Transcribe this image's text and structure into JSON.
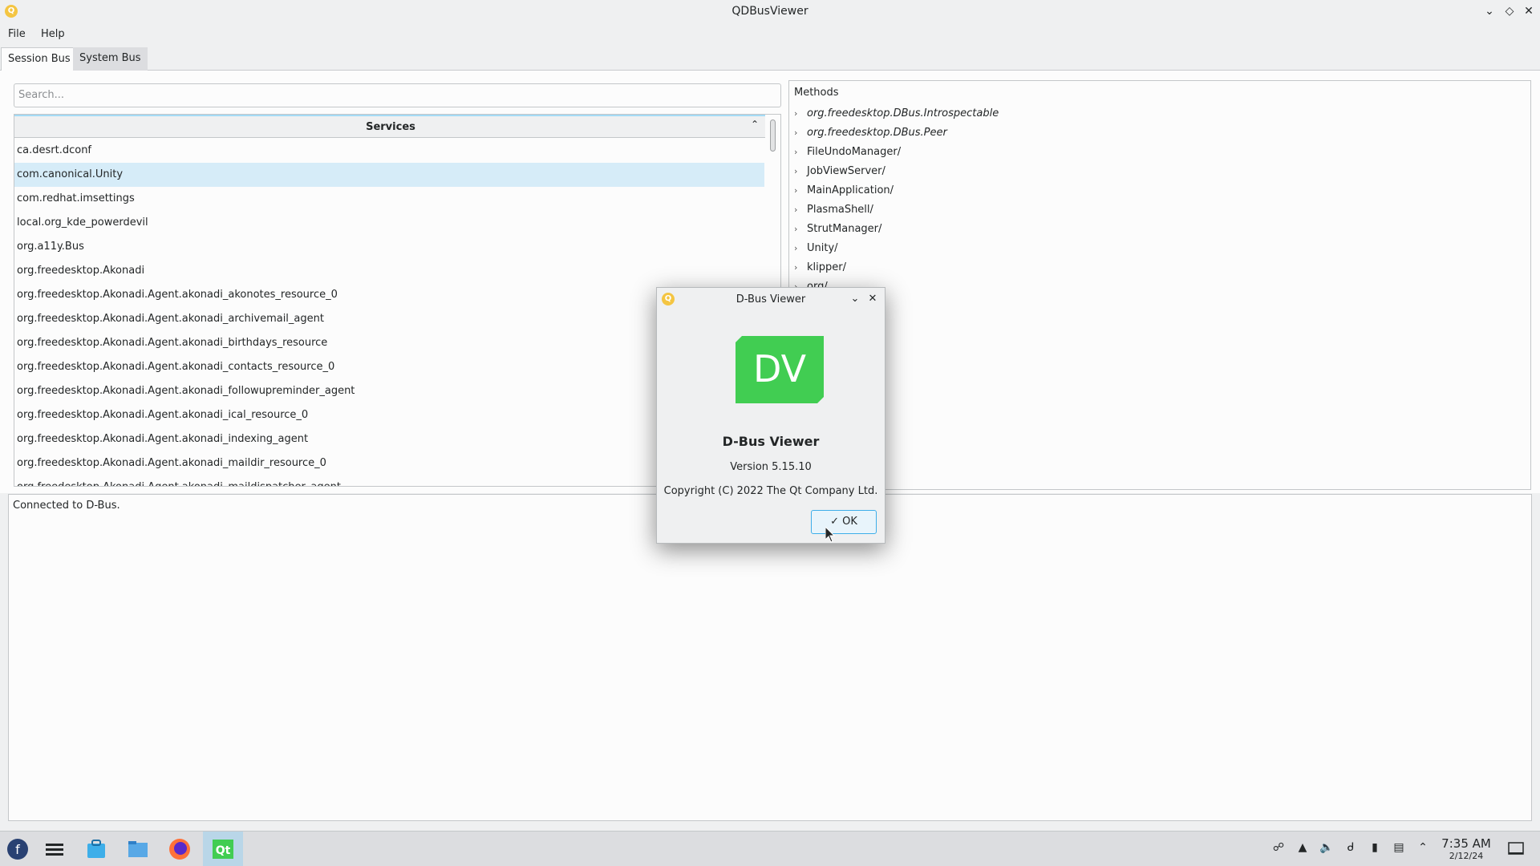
{
  "window": {
    "title": "QDBusViewer",
    "controls": [
      "minimize",
      "maximize",
      "close"
    ]
  },
  "menu": {
    "file": "File",
    "help": "Help"
  },
  "tabs": [
    {
      "label": "Session Bus",
      "active": true
    },
    {
      "label": "System Bus",
      "active": false
    }
  ],
  "search": {
    "placeholder": "Search..."
  },
  "services": {
    "header": "Services",
    "items": [
      "ca.desrt.dconf",
      "com.canonical.Unity",
      "com.redhat.imsettings",
      "local.org_kde_powerdevil",
      "org.a11y.Bus",
      "org.freedesktop.Akonadi",
      "org.freedesktop.Akonadi.Agent.akonadi_akonotes_resource_0",
      "org.freedesktop.Akonadi.Agent.akonadi_archivemail_agent",
      "org.freedesktop.Akonadi.Agent.akonadi_birthdays_resource",
      "org.freedesktop.Akonadi.Agent.akonadi_contacts_resource_0",
      "org.freedesktop.Akonadi.Agent.akonadi_followupreminder_agent",
      "org.freedesktop.Akonadi.Agent.akonadi_ical_resource_0",
      "org.freedesktop.Akonadi.Agent.akonadi_indexing_agent",
      "org.freedesktop.Akonadi.Agent.akonadi_maildir_resource_0",
      "org.freedesktop.Akonadi.Agent.akonadi_maildispatcher_agent"
    ],
    "selected_index": 1
  },
  "methods": {
    "label": "Methods",
    "nodes": [
      {
        "label": "org.freedesktop.DBus.Introspectable",
        "italic": true
      },
      {
        "label": "org.freedesktop.DBus.Peer",
        "italic": true
      },
      {
        "label": "FileUndoManager/",
        "italic": false
      },
      {
        "label": "JobViewServer/",
        "italic": false
      },
      {
        "label": "MainApplication/",
        "italic": false
      },
      {
        "label": "PlasmaShell/",
        "italic": false
      },
      {
        "label": "StrutManager/",
        "italic": false
      },
      {
        "label": "Unity/",
        "italic": false
      },
      {
        "label": "klipper/",
        "italic": false
      },
      {
        "label": "org/",
        "italic": false
      }
    ]
  },
  "log": {
    "text": "Connected to D-Bus."
  },
  "dialog": {
    "title": "D-Bus Viewer",
    "logo_text": "DV",
    "name": "D-Bus Viewer",
    "version": "Version 5.15.10",
    "copyright": "Copyright (C) 2022 The Qt Company Ltd.",
    "ok_label": "OK",
    "logo_color": "#41cd52"
  },
  "taskbar": {
    "time": "7:35 AM",
    "date": "2/12/24"
  },
  "colors": {
    "accent": "#3daee9",
    "selection": "#d6ecf8"
  }
}
